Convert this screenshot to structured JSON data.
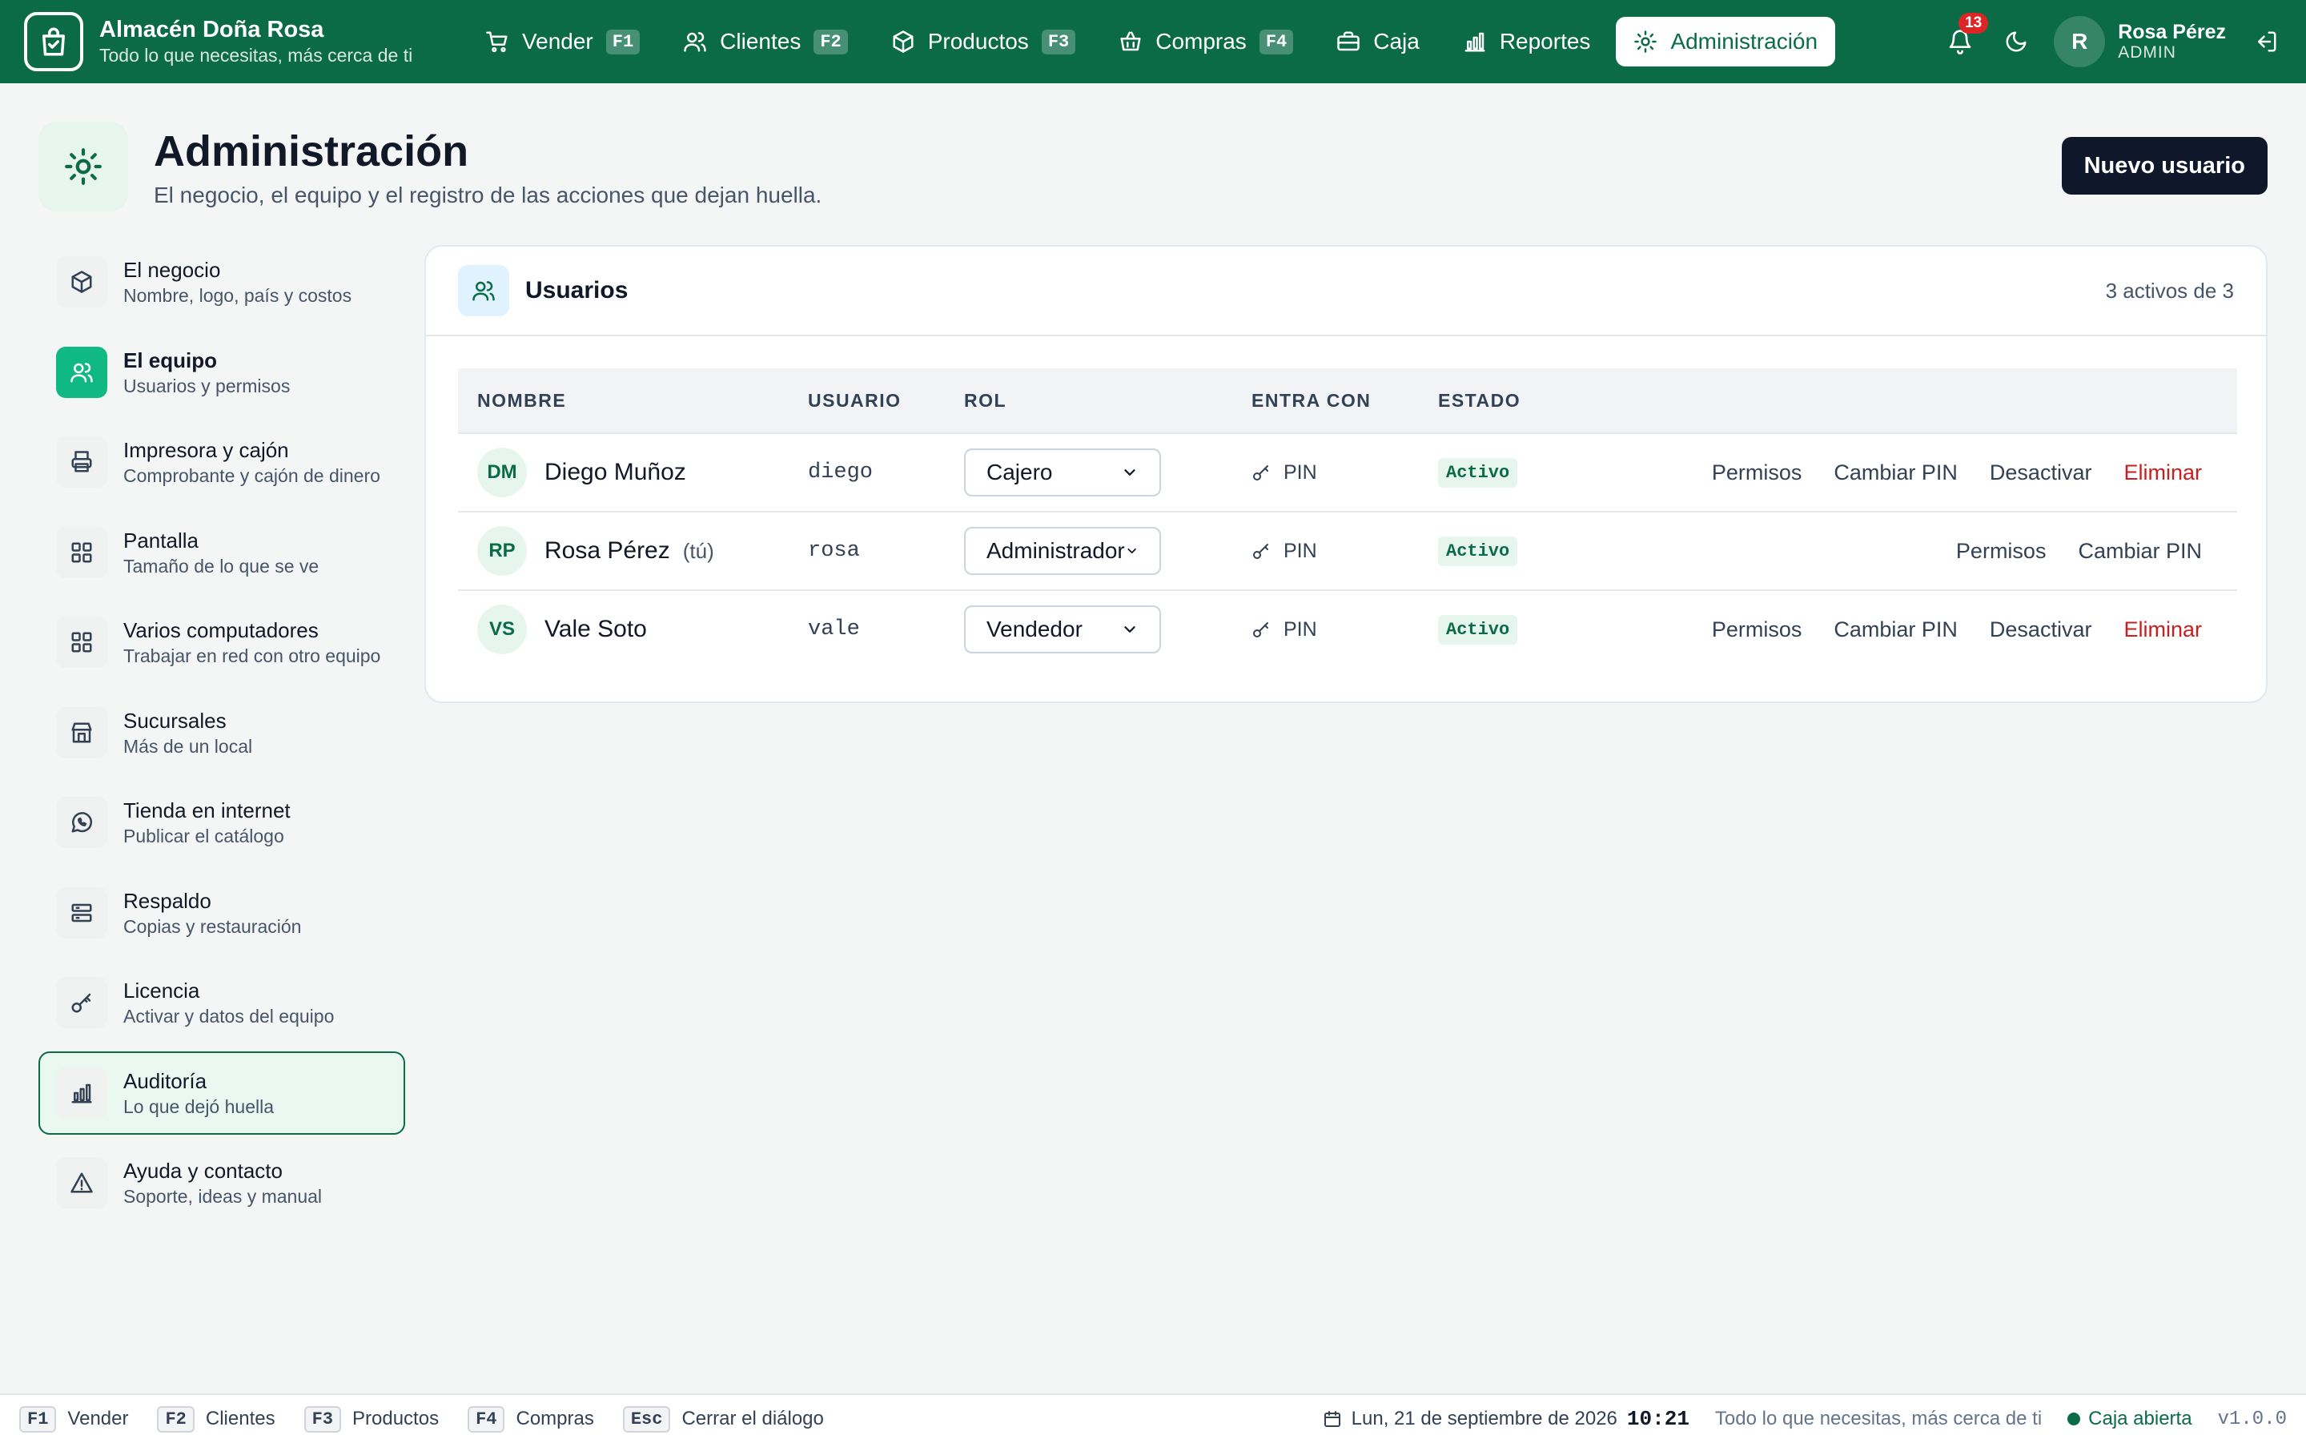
{
  "app": {
    "name": "Almacén Doña Rosa",
    "tagline": "Todo lo que necesitas, más cerca de ti"
  },
  "nav": [
    {
      "label": "Vender",
      "key": "F1",
      "icon": "cart-icon"
    },
    {
      "label": "Clientes",
      "key": "F2",
      "icon": "users-icon"
    },
    {
      "label": "Productos",
      "key": "F3",
      "icon": "box-icon"
    },
    {
      "label": "Compras",
      "key": "F4",
      "icon": "basket-icon"
    },
    {
      "label": "Caja",
      "key": "",
      "icon": "register-icon"
    },
    {
      "label": "Reportes",
      "key": "",
      "icon": "chart-icon"
    },
    {
      "label": "Administración",
      "key": "",
      "icon": "sun-gear-icon",
      "active": true
    }
  ],
  "notifications": {
    "count": "13"
  },
  "user": {
    "initial": "R",
    "name": "Rosa Pérez",
    "role": "ADMIN"
  },
  "page": {
    "title": "Administración",
    "subtitle": "El negocio, el equipo y el registro de las acciones que dejan huella.",
    "new_user_label": "Nuevo usuario"
  },
  "sidebar": [
    {
      "label": "El negocio",
      "desc": "Nombre, logo, país y costos"
    },
    {
      "label": "El equipo",
      "desc": "Usuarios y permisos"
    },
    {
      "label": "Impresora y cajón",
      "desc": "Comprobante y cajón de dinero"
    },
    {
      "label": "Pantalla",
      "desc": "Tamaño de lo que se ve"
    },
    {
      "label": "Varios computadores",
      "desc": "Trabajar en red con otro equipo"
    },
    {
      "label": "Sucursales",
      "desc": "Más de un local"
    },
    {
      "label": "Tienda en internet",
      "desc": "Publicar el catálogo"
    },
    {
      "label": "Respaldo",
      "desc": "Copias y restauración"
    },
    {
      "label": "Licencia",
      "desc": "Activar y datos del equipo"
    },
    {
      "label": "Auditoría",
      "desc": "Lo que dejó huella"
    },
    {
      "label": "Ayuda y contacto",
      "desc": "Soporte, ideas y manual"
    }
  ],
  "users_card": {
    "title": "Usuarios",
    "count": "3 activos de 3",
    "columns": [
      "NOMBRE",
      "USUARIO",
      "ROL",
      "ENTRA CON",
      "ESTADO"
    ],
    "rows": [
      {
        "initials": "DM",
        "name": "Diego Muñoz",
        "you": "",
        "login": "diego",
        "role": "Cajero",
        "auth": "PIN",
        "status": "Activo",
        "actions": [
          "Permisos",
          "Cambiar PIN",
          "Desactivar",
          "Eliminar"
        ]
      },
      {
        "initials": "RP",
        "name": "Rosa Pérez",
        "you": "(tú)",
        "login": "rosa",
        "role": "Administrador",
        "auth": "PIN",
        "status": "Activo",
        "actions": [
          "Permisos",
          "Cambiar PIN"
        ]
      },
      {
        "initials": "VS",
        "name": "Vale Soto",
        "you": "",
        "login": "vale",
        "role": "Vendedor",
        "auth": "PIN",
        "status": "Activo",
        "actions": [
          "Permisos",
          "Cambiar PIN",
          "Desactivar",
          "Eliminar"
        ]
      }
    ]
  },
  "footer": {
    "shortcuts": [
      {
        "key": "F1",
        "label": "Vender"
      },
      {
        "key": "F2",
        "label": "Clientes"
      },
      {
        "key": "F3",
        "label": "Productos"
      },
      {
        "key": "F4",
        "label": "Compras"
      },
      {
        "key": "Esc",
        "label": "Cerrar el diálogo"
      }
    ],
    "date": "Lun, 21 de septiembre de 2026",
    "time": "10:21",
    "tagline": "Todo lo que necesitas, más cerca de ti",
    "register_status": "Caja abierta",
    "version": "v1.0.0"
  },
  "colors": {
    "brand": "#0b6b47",
    "danger": "#c81e1e",
    "dark": "#0f172a"
  }
}
